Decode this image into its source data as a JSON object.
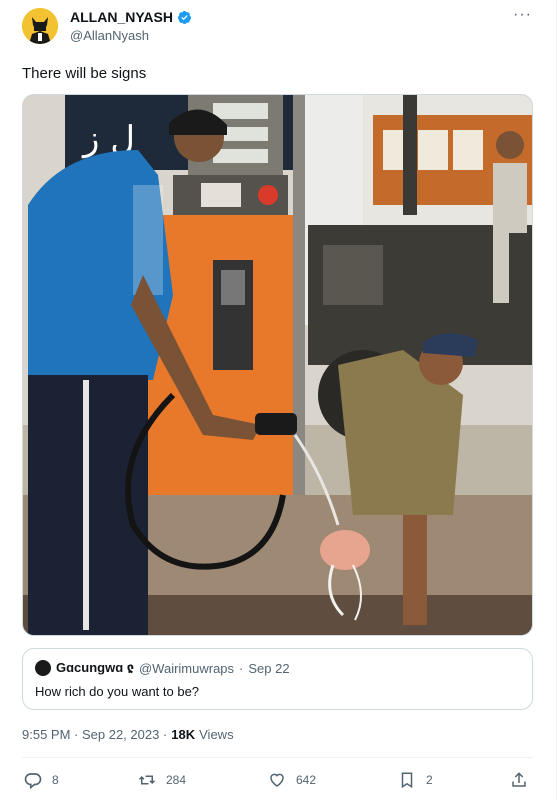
{
  "author": {
    "display_name": "ALLAN_NYASH",
    "handle": "@AllanNyash",
    "more_label": "···"
  },
  "tweet": {
    "text": "There will be signs"
  },
  "media": {
    "icon": "photo-image"
  },
  "quote": {
    "display_name": "Gɑcungwɑ ჺ",
    "handle": "@Wairimuwraps",
    "separator": "·",
    "date": "Sep 22",
    "text": "How rich do you want to be?"
  },
  "meta": {
    "time_date": "9:55 PM · Sep 22, 2023 ·",
    "views_count": "18K",
    "views_label": "Views"
  },
  "actions": {
    "replies": "8",
    "retweets": "284",
    "likes": "642",
    "bookmarks": "2"
  },
  "colors": {
    "verified": "#1d9bf0",
    "secondary_text": "#536471",
    "border": "#cfd9de"
  }
}
